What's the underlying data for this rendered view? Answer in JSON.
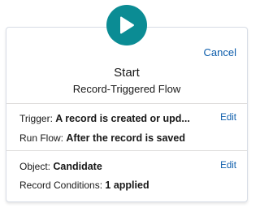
{
  "start_icon": "play-icon",
  "colors": {
    "accent": "#0b8c94",
    "link": "#0b5cab",
    "border": "#d8dde6"
  },
  "header": {
    "cancel_label": "Cancel",
    "title": "Start",
    "subtitle": "Record-Triggered Flow"
  },
  "trigger_section": {
    "edit_label": "Edit",
    "trigger_label": "Trigger:",
    "trigger_value": "A record is created or upd...",
    "run_flow_label": "Run Flow:",
    "run_flow_value": "After the record is saved"
  },
  "object_section": {
    "edit_label": "Edit",
    "object_label": "Object:",
    "object_value": "Candidate",
    "conditions_label": "Record Conditions:",
    "conditions_value": "1 applied"
  }
}
